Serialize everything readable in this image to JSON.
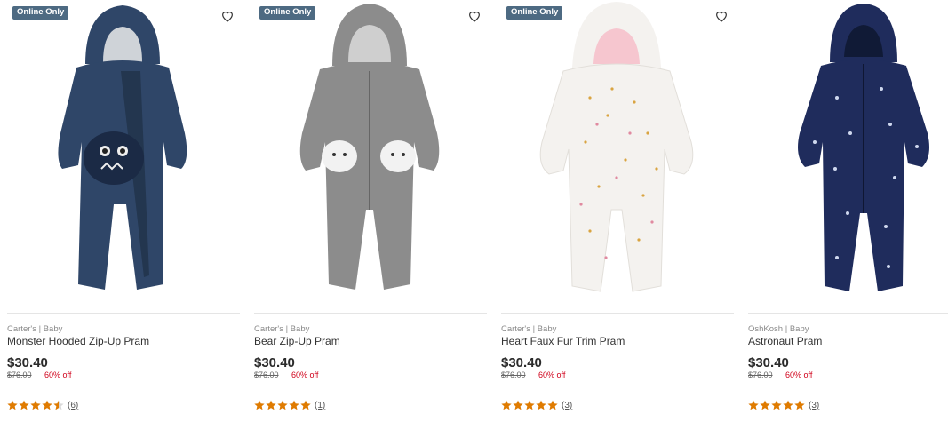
{
  "products": [
    {
      "badge": "Online Only",
      "brand": "Carter's | Baby",
      "name": "Monster Hooded Zip-Up Pram",
      "price": "$30.40",
      "was": "$76.00",
      "off": "60% off",
      "rating": 4.5,
      "reviews": "(6)",
      "color": "#2f4668",
      "image": "monster-pram"
    },
    {
      "badge": "Online Only",
      "brand": "Carter's | Baby",
      "name": "Bear Zip-Up Pram",
      "price": "$30.40",
      "was": "$76.00",
      "off": "60% off",
      "rating": 5,
      "reviews": "(1)",
      "color": "#8c8c8c",
      "image": "bear-pram"
    },
    {
      "badge": "Online Only",
      "brand": "Carter's | Baby",
      "name": "Heart Faux Fur Trim Pram",
      "price": "$30.40",
      "was": "$76.00",
      "off": "60% off",
      "rating": 5,
      "reviews": "(3)",
      "color": "#f4f2ef",
      "image": "heart-pram"
    },
    {
      "badge": "",
      "brand": "OshKosh | Baby",
      "name": "Astronaut Pram",
      "price": "$30.40",
      "was": "$76.00",
      "off": "60% off",
      "rating": 5,
      "reviews": "(3)",
      "color": "#1f2c5c",
      "image": "astronaut-pram"
    }
  ],
  "colors": {
    "badge": "#4d6a82",
    "sale": "#d0021b",
    "star": "#e07b00"
  }
}
